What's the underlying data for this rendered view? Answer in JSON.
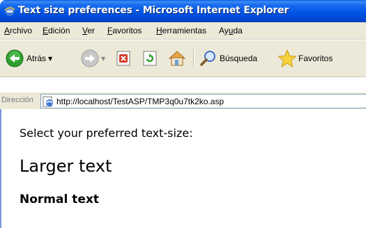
{
  "window": {
    "title": "Text size preferences - Microsoft Internet Explorer"
  },
  "menu": {
    "items": [
      {
        "mnemonic": "A",
        "rest": "rchivo"
      },
      {
        "mnemonic": "E",
        "rest": "dición"
      },
      {
        "mnemonic": "V",
        "rest": "er"
      },
      {
        "mnemonic": "F",
        "rest": "avoritos"
      },
      {
        "mnemonic": "H",
        "rest": "erramientas"
      },
      {
        "pre": "Ay",
        "mnemonic": "u",
        "rest": "da"
      }
    ]
  },
  "toolbar": {
    "back_label": "Atrás",
    "search_label": "Búsqueda",
    "favorites_label": "Favoritos"
  },
  "address": {
    "label": "Dirección",
    "url": "http://localhost/TestASP/TMP3q0u7tk2ko.asp"
  },
  "content": {
    "prompt": "Select your preferred text-size:",
    "larger_text": "Larger text",
    "normal_text": "Normal text"
  },
  "colors": {
    "titlebar": "#0055e5",
    "chrome": "#ece9d8",
    "back_green": "#2e9e2e",
    "stop_red": "#d43a2a"
  }
}
